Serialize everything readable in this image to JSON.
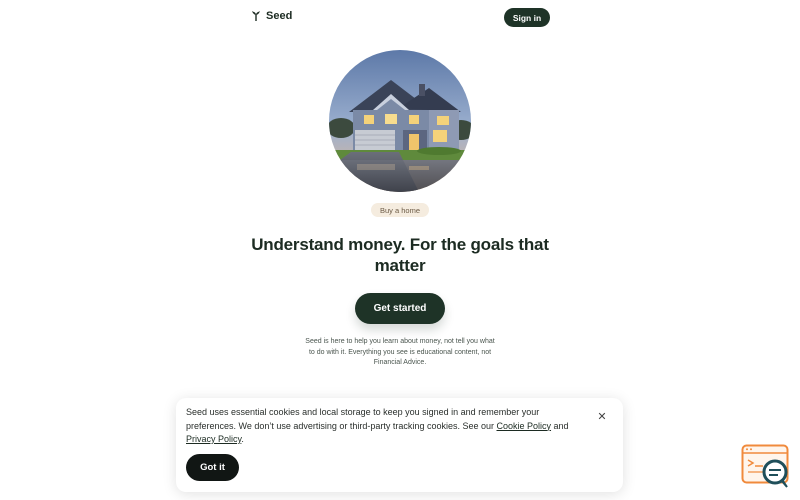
{
  "header": {
    "brand_name": "Seed",
    "sign_in_label": "Sign in"
  },
  "hero": {
    "goal_chip": "Buy a home",
    "headline": "Understand money. For the goals that matter",
    "cta_label": "Get started",
    "disclaimer": "Seed is here to help you learn about money, not tell you what to do with it. Everything you see is educational content, not Financial Advice."
  },
  "cookie_banner": {
    "text_before": "Seed uses essential cookies and local storage to keep you signed in and remember your preferences. We don’t use advertising or third-party tracking cookies. See our ",
    "cookie_policy_link": "Cookie Policy",
    "text_middle": " and ",
    "privacy_policy_link": "Privacy Policy",
    "text_after": ".",
    "accept_label": "Got it",
    "close_icon": "close-icon"
  },
  "icons": {
    "logo": "seedling-icon",
    "help_widget": "help-chat-icon"
  },
  "colors": {
    "primary": "#1e3327",
    "chip_bg": "#f5ecdf",
    "widget_accent": "#f08a3c"
  }
}
